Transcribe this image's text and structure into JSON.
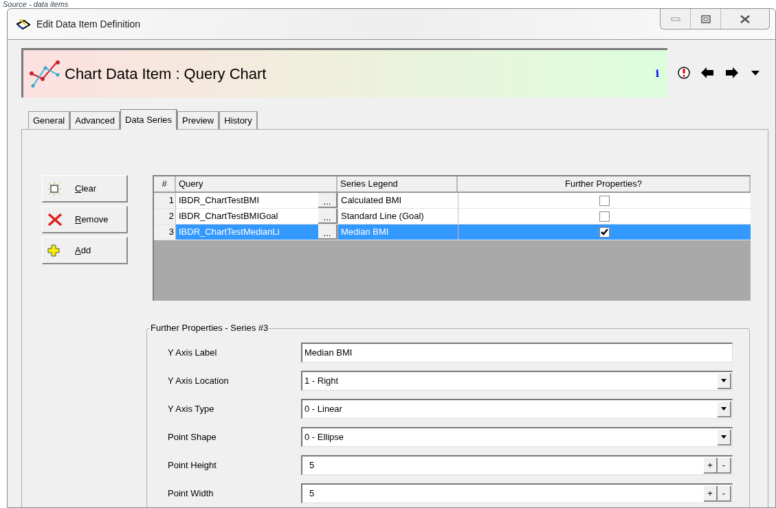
{
  "caption": "Source - data items",
  "window": {
    "title": "Edit Data Item Definition"
  },
  "header": {
    "title": "Chart Data Item : Query Chart",
    "info": "i"
  },
  "tabs": [
    {
      "label": "General",
      "selected": false
    },
    {
      "label": "Advanced",
      "selected": false
    },
    {
      "label": "Data Series",
      "selected": true
    },
    {
      "label": "Preview",
      "selected": false
    },
    {
      "label": "History",
      "selected": false
    }
  ],
  "buttons": [
    {
      "kind": "clear",
      "label": "Clear",
      "first_letter_underlined": true
    },
    {
      "kind": "remove",
      "label": "Remove",
      "first_letter_underlined": true
    },
    {
      "kind": "add",
      "label": "Add",
      "first_letter_underlined": true
    }
  ],
  "grid": {
    "columns": [
      "#",
      "Query",
      "Series Legend",
      "Further Properties?"
    ],
    "rows": [
      {
        "number": "1",
        "query": "IBDR_ChartTestBMI",
        "browse": "...",
        "legend": "Calculated BMI",
        "further_properties": false,
        "selected": false
      },
      {
        "number": "2",
        "query": "IBDR_ChartTestBMIGoal",
        "browse": "...",
        "legend": "Standard Line (Goal)",
        "further_properties": false,
        "selected": false
      },
      {
        "number": "3",
        "query": "IBDR_ChartTestMedianLi",
        "browse": "...",
        "legend": "Median BMI",
        "further_properties": true,
        "selected": true
      }
    ]
  },
  "properties": {
    "title": "Further Properties - Series #3",
    "fields": [
      {
        "kind": "text",
        "label": "Y Axis Label",
        "value": "Median BMI"
      },
      {
        "kind": "dropdown",
        "label": "Y Axis Location",
        "value": "1 - Right"
      },
      {
        "kind": "dropdown",
        "label": "Y Axis Type",
        "value": "0 - Linear"
      },
      {
        "kind": "dropdown",
        "label": "Point Shape",
        "value": "0 - Ellipse"
      },
      {
        "kind": "spinner",
        "label": "Point Height",
        "value": "5",
        "plus": "+",
        "minus": "-"
      },
      {
        "kind": "spinner",
        "label": "Point Width",
        "value": "5",
        "plus": "+",
        "minus": "-"
      }
    ]
  }
}
